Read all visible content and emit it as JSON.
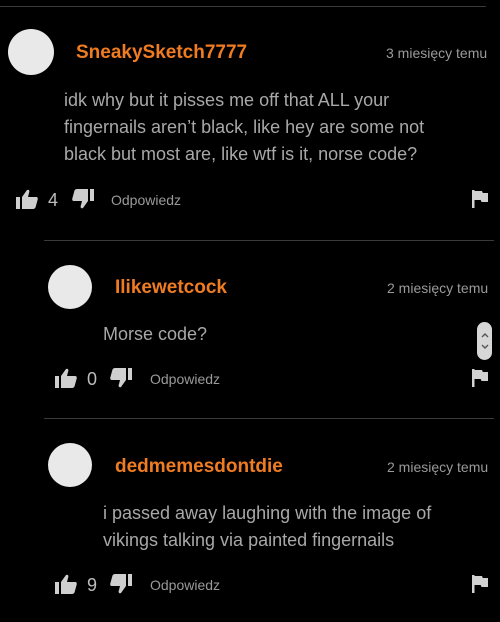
{
  "comments": [
    {
      "username": "SneakySketch7777",
      "time": "3 miesięcy temu",
      "text": "idk why but it pisses me off that ALL your fingernails aren’t black, like hey are some not black but most are, like wtf is it, norse code?",
      "likes": "4",
      "reply_label": "Odpowiedz"
    },
    {
      "username": "Ilikewetcock",
      "time": "2 miesięcy temu",
      "text": "Morse code?",
      "likes": "0",
      "reply_label": "Odpowiedz"
    },
    {
      "username": "dedmemesdontdie",
      "time": "2 miesięcy temu",
      "text": "i passed away laughing with the image of vikings talking via painted fingernails",
      "likes": "9",
      "reply_label": "Odpowiedz"
    }
  ],
  "icons": {
    "like": "thumbs-up-icon",
    "dislike": "thumbs-down-icon",
    "flag": "flag-icon",
    "scroll": "scroll-handle"
  },
  "colors": {
    "background": "#000000",
    "username": "#f07c22",
    "text": "#a8a8a8",
    "meta": "#9a9a9a"
  }
}
